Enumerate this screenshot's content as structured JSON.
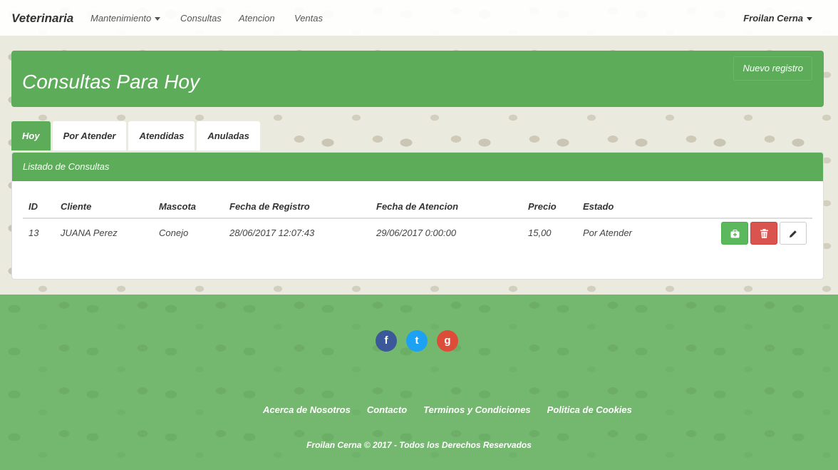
{
  "navbar": {
    "brand": "Veterinaria",
    "items": [
      {
        "label": "Mantenimiento",
        "dropdown": true
      },
      {
        "label": "Consultas"
      },
      {
        "label": "Atencion"
      },
      {
        "label": "Ventas"
      }
    ],
    "user": "Froilan Cerna"
  },
  "header": {
    "title": "Consultas Para Hoy",
    "new_button": "Nuevo registro"
  },
  "tabs": [
    {
      "label": "Hoy",
      "active": true
    },
    {
      "label": "Por Atender"
    },
    {
      "label": "Atendidas"
    },
    {
      "label": "Anuladas"
    }
  ],
  "list": {
    "heading": "Listado de Consultas",
    "columns": [
      "ID",
      "Cliente",
      "Mascota",
      "Fecha de Registro",
      "Fecha de Atencion",
      "Precio",
      "Estado",
      ""
    ],
    "rows": [
      {
        "id": "13",
        "cliente": "JUANA Perez",
        "mascota": "Conejo",
        "fecha_registro": "28/06/2017 12:07:43",
        "fecha_atencion": "29/06/2017 0:00:00",
        "precio": "15,00",
        "estado": "Por Atender",
        "actions": [
          "medkit-icon",
          "trash-icon",
          "pencil-icon"
        ]
      }
    ]
  },
  "footer": {
    "social": [
      {
        "icon": "facebook-icon",
        "glyph": "f",
        "color": "#3b5998"
      },
      {
        "icon": "twitter-icon",
        "glyph": "t",
        "color": "#1da1f2"
      },
      {
        "icon": "google-plus-icon",
        "glyph": "g",
        "color": "#dd4b39"
      }
    ],
    "links": [
      "Acerca de Nosotros",
      "Contacto",
      "Terminos y Condiciones",
      "Politica de Cookies"
    ],
    "copyright": "Froilan Cerna © 2017 - Todos los Derechos Reservados"
  },
  "colors": {
    "primary_green": "#5cac5a",
    "footer_green": "#74b86f",
    "danger": "#d9534f"
  }
}
